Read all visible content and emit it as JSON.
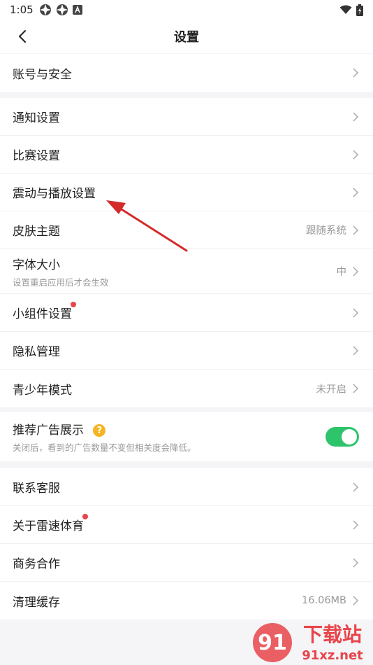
{
  "status": {
    "time": "1:05"
  },
  "nav": {
    "title": "设置"
  },
  "groups": {
    "account": {
      "label": "账号与安全"
    },
    "notify": {
      "label": "通知设置"
    },
    "match": {
      "label": "比赛设置"
    },
    "vibration": {
      "label": "震动与播放设置"
    },
    "skin": {
      "label": "皮肤主题",
      "value": "跟随系统"
    },
    "font": {
      "label": "字体大小",
      "sub": "设置重启应用后才会生效",
      "value": "中"
    },
    "widget": {
      "label": "小组件设置"
    },
    "privacy": {
      "label": "隐私管理"
    },
    "youth": {
      "label": "青少年模式",
      "value": "未开启"
    },
    "ads": {
      "label": "推荐广告展示",
      "help": "?",
      "sub": "关闭后，看到的广告数量不变但相关度会降低。",
      "toggle_on": true
    },
    "service": {
      "label": "联系客服"
    },
    "about": {
      "label": "关于雷速体育"
    },
    "business": {
      "label": "商务合作"
    },
    "cache": {
      "label": "清理缓存",
      "value": "16.06MB"
    }
  },
  "watermark": {
    "text": "下载站",
    "url": "91xz.net"
  },
  "colors": {
    "toggle": "#2ec46b",
    "dot": "#e8444a",
    "arrow": "#d42a2a",
    "help": "#f5b423"
  }
}
